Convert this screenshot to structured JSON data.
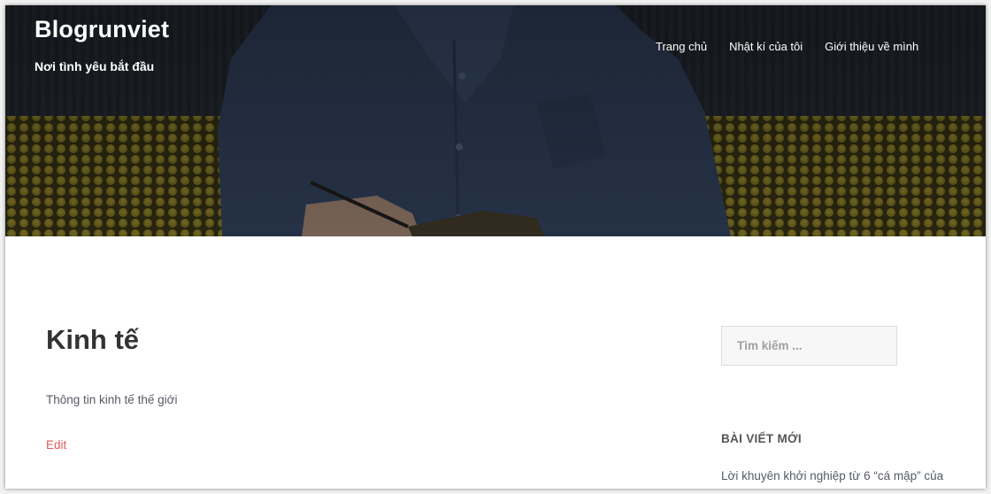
{
  "site": {
    "title": "Blogrunviet",
    "tagline": "Nơi tình yêu bắt đầu"
  },
  "nav": {
    "items": [
      {
        "label": "Trang chủ"
      },
      {
        "label": "Nhật kí của tôi"
      },
      {
        "label": "Giới thiệu về mình"
      }
    ]
  },
  "page": {
    "title": "Kinh tế",
    "description": "Thông tin kinh tế thế giới",
    "edit_label": "Edit"
  },
  "sidebar": {
    "search_placeholder": "Tìm kiếm ...",
    "recent_title": "BÀI VIẾT MỚI",
    "recent_posts": [
      {
        "label": "Lời khuyên khởi nghiệp từ 6 “cá mập” của"
      }
    ]
  },
  "colors": {
    "accent_link": "#e2595b",
    "heading": "#333333",
    "body_text": "#555a64"
  }
}
